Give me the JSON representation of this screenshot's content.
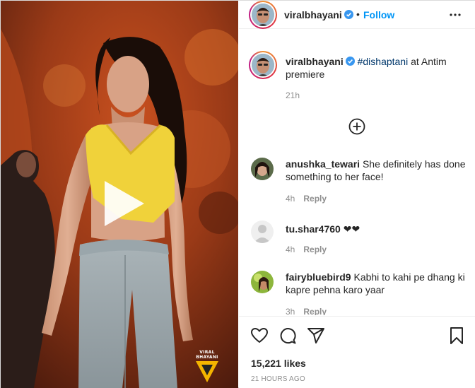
{
  "post": {
    "username": "viralbhayani",
    "follow_label": "Follow",
    "separator": "•",
    "caption": {
      "username": "viralbhayani",
      "hashtag": "#dishaptani",
      "text": " at Antim premiere",
      "time": "21h"
    },
    "watermark": "VIRAL BHAYANI",
    "comments": [
      {
        "username": "anushka_tewari",
        "text": "She definitely has done something to her face!",
        "time": "4h",
        "reply_label": "Reply"
      },
      {
        "username": "tu.shar4760",
        "text": "❤❤",
        "time": "4h",
        "reply_label": "Reply"
      },
      {
        "username": "fairybluebird9",
        "text": "Kabhi to kahi pe dhang ki kapre pehna karo yaar",
        "time": "3h",
        "reply_label": "Reply"
      }
    ],
    "likes": "15,221 likes",
    "timestamp": "21 HOURS AGO"
  },
  "icons": {
    "verified": "verified-badge-icon",
    "more": "more-options-icon",
    "load_more": "plus-circle-icon",
    "like": "heart-icon",
    "comment": "comment-bubble-icon",
    "share": "paper-plane-icon",
    "save": "bookmark-icon",
    "play": "play-icon"
  },
  "colors": {
    "link_blue": "#0095f6",
    "hashtag": "#00376b",
    "muted": "#8e8e8e",
    "text": "#262626",
    "verified": "#3897f0"
  }
}
